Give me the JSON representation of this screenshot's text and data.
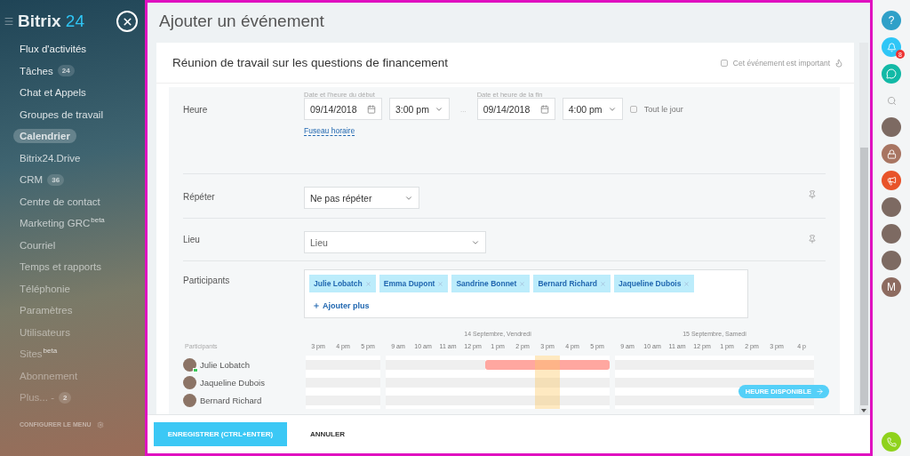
{
  "sidebar": {
    "logo": {
      "brand": "Bitrix",
      "suffix": "24"
    },
    "items": [
      {
        "label": "Flux d'activités",
        "selected": false
      },
      {
        "label": "Tâches",
        "counter": "24",
        "selected": false
      },
      {
        "label": "Chat et Appels",
        "selected": false
      },
      {
        "label": "Groupes de travail",
        "selected": false
      },
      {
        "label": "Calendrier",
        "selected": true
      },
      {
        "label": "Bitrix24.Drive",
        "selected": false
      },
      {
        "label": "CRM",
        "counter": "36",
        "selected": false
      },
      {
        "label": "Centre de contact",
        "selected": false
      },
      {
        "label": "Marketing GRC",
        "sup": "beta",
        "selected": false
      },
      {
        "label": "Courriel",
        "selected": false
      },
      {
        "label": "Temps et rapports",
        "selected": false
      },
      {
        "label": "Téléphonie",
        "selected": false
      },
      {
        "label": "Paramètres",
        "selected": false
      },
      {
        "label": "Utilisateurs",
        "selected": false
      },
      {
        "label": "Sites",
        "sup": "beta",
        "selected": false
      },
      {
        "label": "Abonnement",
        "selected": false
      },
      {
        "label": "Plus... -",
        "counter": "2",
        "selected": false
      }
    ],
    "configure": "CONFIGURER LE MENU"
  },
  "panel": {
    "title": "Ajouter un événement",
    "event_title": "Réunion de travail sur les questions de financement",
    "important": {
      "label": "Cet événement est important",
      "checked": false
    },
    "time": {
      "label": "Heure",
      "start_label": "Date et l'heure du début",
      "start_date": "09/14/2018",
      "start_time": "3:00 pm",
      "separator": "...",
      "end_label": "Date et heure de la fin",
      "end_date": "09/14/2018",
      "end_time": "4:00 pm",
      "all_day": {
        "label": "Tout le jour",
        "checked": false
      },
      "timezone_link": "Fuseau horaire"
    },
    "repeat": {
      "label": "Répéter",
      "value": "Ne pas répéter"
    },
    "location": {
      "label": "Lieu",
      "value": "Lieu"
    },
    "participants": {
      "label": "Participants",
      "people": [
        "Julie Lobatch",
        "Emma Dupont",
        "Sandrine Bonnet",
        "Bernard Richard",
        "Jaqueline Dubois"
      ],
      "add_label": "Ajouter plus"
    },
    "planner": {
      "header": "Participants",
      "days": [
        {
          "hours": [
            {
              "label": "3 pm",
              "selected": false
            },
            {
              "label": "4 pm",
              "selected": false
            },
            {
              "label": "5 pm",
              "selected": false
            }
          ]
        },
        {
          "label": "14 Septembre, Vendredi",
          "hours": [
            {
              "label": "9 am",
              "selected": false
            },
            {
              "label": "10 am",
              "selected": false
            },
            {
              "label": "11 am",
              "selected": false
            },
            {
              "label": "12 pm",
              "selected": false
            },
            {
              "label": "1 pm",
              "selected": false
            },
            {
              "label": "2 pm",
              "selected": false
            },
            {
              "label": "3 pm",
              "selected": true
            },
            {
              "label": "4 pm",
              "selected": false
            },
            {
              "label": "5 pm",
              "selected": false
            }
          ]
        },
        {
          "label": "15 Septembre, Samedi",
          "hours": [
            {
              "label": "9 am",
              "selected": false
            },
            {
              "label": "10 am",
              "selected": false
            },
            {
              "label": "11 am",
              "selected": false
            },
            {
              "label": "12 pm",
              "selected": false
            },
            {
              "label": "1 pm",
              "selected": false
            },
            {
              "label": "2 pm",
              "selected": false
            },
            {
              "label": "3 pm",
              "selected": false
            },
            {
              "label": "4 p",
              "selected": false
            }
          ]
        }
      ],
      "rows": [
        {
          "name": "Julie Lobatch",
          "online": true,
          "busy": [
            [
              false,
              false,
              false
            ],
            [
              false,
              false,
              false,
              false,
              true,
              true,
              true,
              true,
              true
            ],
            [
              false,
              false,
              false,
              false,
              false,
              false,
              false,
              false
            ]
          ]
        },
        {
          "name": "Jaqueline Dubois",
          "online": false,
          "busy": [
            [
              false,
              false,
              false
            ],
            [
              false,
              false,
              false,
              false,
              false,
              false,
              false,
              false,
              false
            ],
            [
              false,
              false,
              false,
              false,
              false,
              false,
              false,
              false
            ]
          ]
        },
        {
          "name": "Bernard Richard",
          "online": false,
          "busy": [
            [
              false,
              false,
              false
            ],
            [
              false,
              false,
              false,
              false,
              false,
              false,
              false,
              false,
              false
            ],
            [
              false,
              false,
              false,
              false,
              false,
              false,
              false,
              false
            ]
          ]
        }
      ],
      "free_slot_button": "HEURE DISPONIBLE"
    },
    "save_button": "ENREGISTRER (CTRL+ENTER)",
    "cancel_button": "ANNULER"
  },
  "right_bar": [
    {
      "kind": "help",
      "text": "?"
    },
    {
      "kind": "notifications",
      "badge": "8"
    },
    {
      "kind": "chat"
    },
    {
      "kind": "search"
    },
    {
      "kind": "avatar"
    },
    {
      "kind": "lock"
    },
    {
      "kind": "megaphone"
    },
    {
      "kind": "avatar"
    },
    {
      "kind": "avatar"
    },
    {
      "kind": "avatar"
    },
    {
      "kind": "letter",
      "text": "M"
    },
    {
      "kind": "phone"
    }
  ]
}
